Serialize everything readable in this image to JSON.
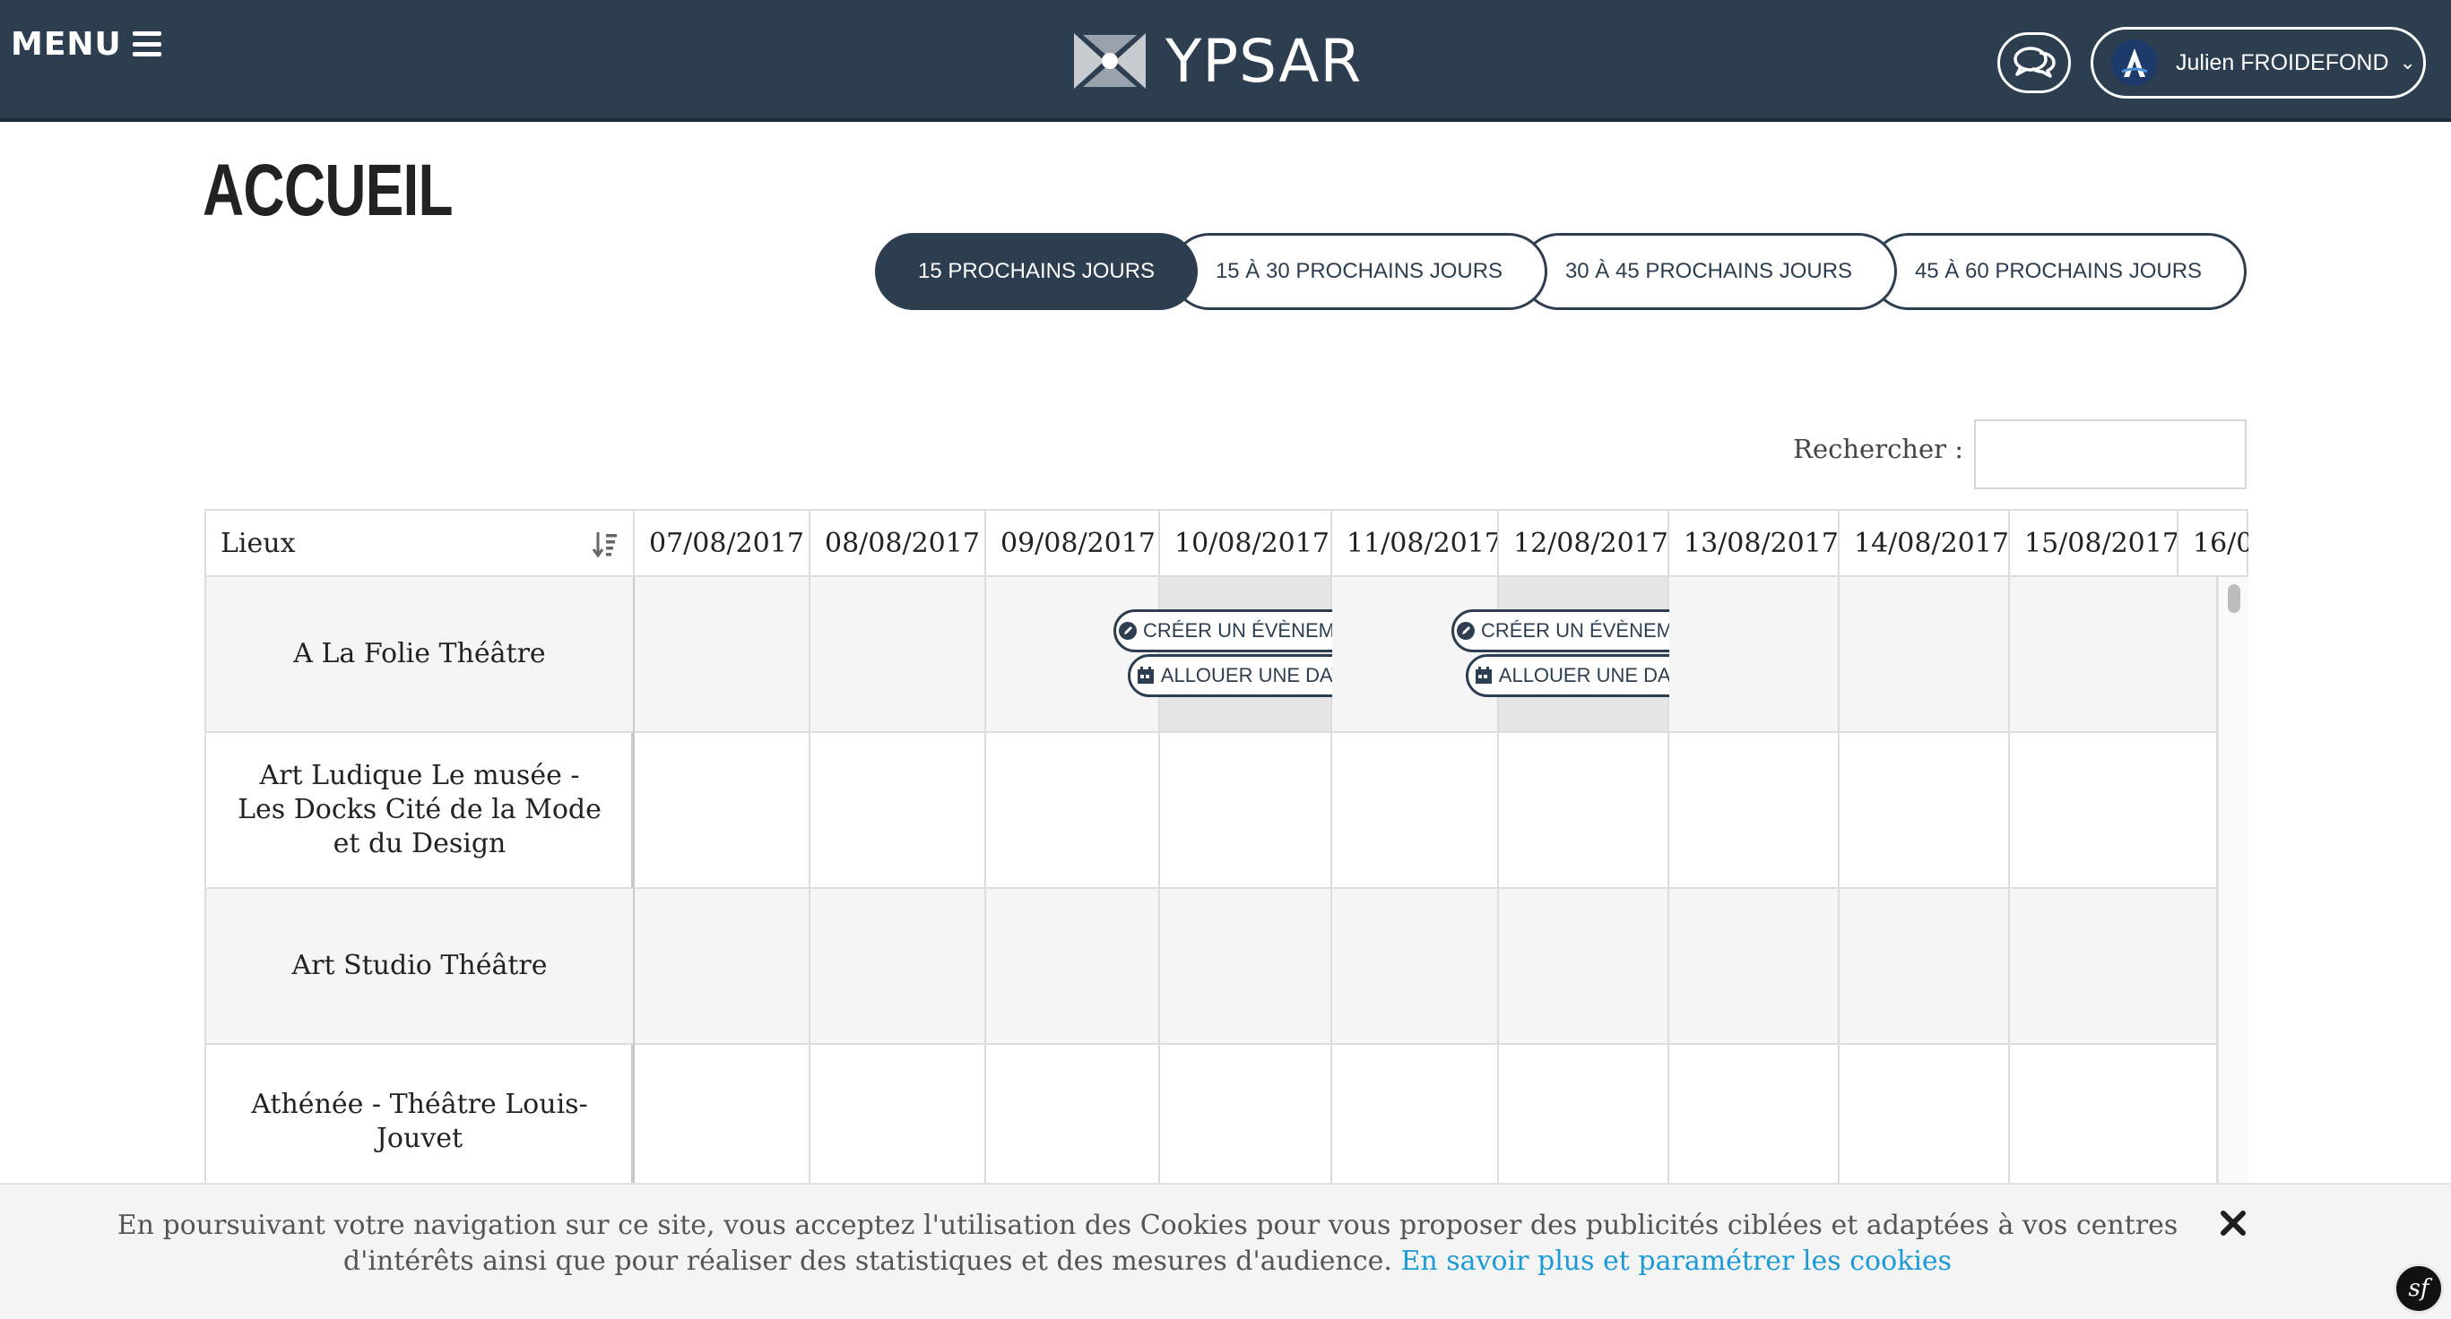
{
  "header": {
    "menu_label": "MENU",
    "brand_name": "YPSAR",
    "user_name": "Julien FROIDEFOND",
    "colors": {
      "bar": "#2c3e50",
      "accent": "#1a9ad6"
    }
  },
  "page": {
    "title": "ACCUEIL"
  },
  "tabs": [
    {
      "label": "15 PROCHAINS JOURS",
      "active": true
    },
    {
      "label": "15 À 30 PROCHAINS JOURS",
      "active": false
    },
    {
      "label": "30 À 45 PROCHAINS JOURS",
      "active": false
    },
    {
      "label": "45 À 60 PROCHAINS JOURS",
      "active": false
    }
  ],
  "search": {
    "label": "Rechercher :",
    "value": ""
  },
  "table": {
    "first_col_header": "Lieux",
    "dates": [
      "07/08/2017",
      "08/08/2017",
      "09/08/2017",
      "10/08/2017",
      "11/08/2017",
      "12/08/2017",
      "13/08/2017",
      "14/08/2017",
      "15/08/2017",
      "16/0"
    ],
    "venues": [
      "A La Folie Théâtre",
      "Art Ludique Le musée - Les Docks Cité de la Mode et du Design",
      "Art Studio Théâtre",
      "Athénée - Théâtre Louis-Jouvet"
    ],
    "event_buttons": {
      "create_label": "CRÉER UN ÉVÈNEMENT",
      "allocate_label": "ALLOUER UNE DATE"
    }
  },
  "cookie_banner": {
    "text": "En poursuivant votre navigation sur ce site, vous acceptez l'utilisation des Cookies pour vous proposer des publicités ciblées et adaptées à vos centres d'intérêts ainsi que pour réaliser des statistiques et des mesures d'audience.",
    "link_text": "En savoir plus et paramétrer les cookies"
  },
  "badge": {
    "label": "sf"
  }
}
